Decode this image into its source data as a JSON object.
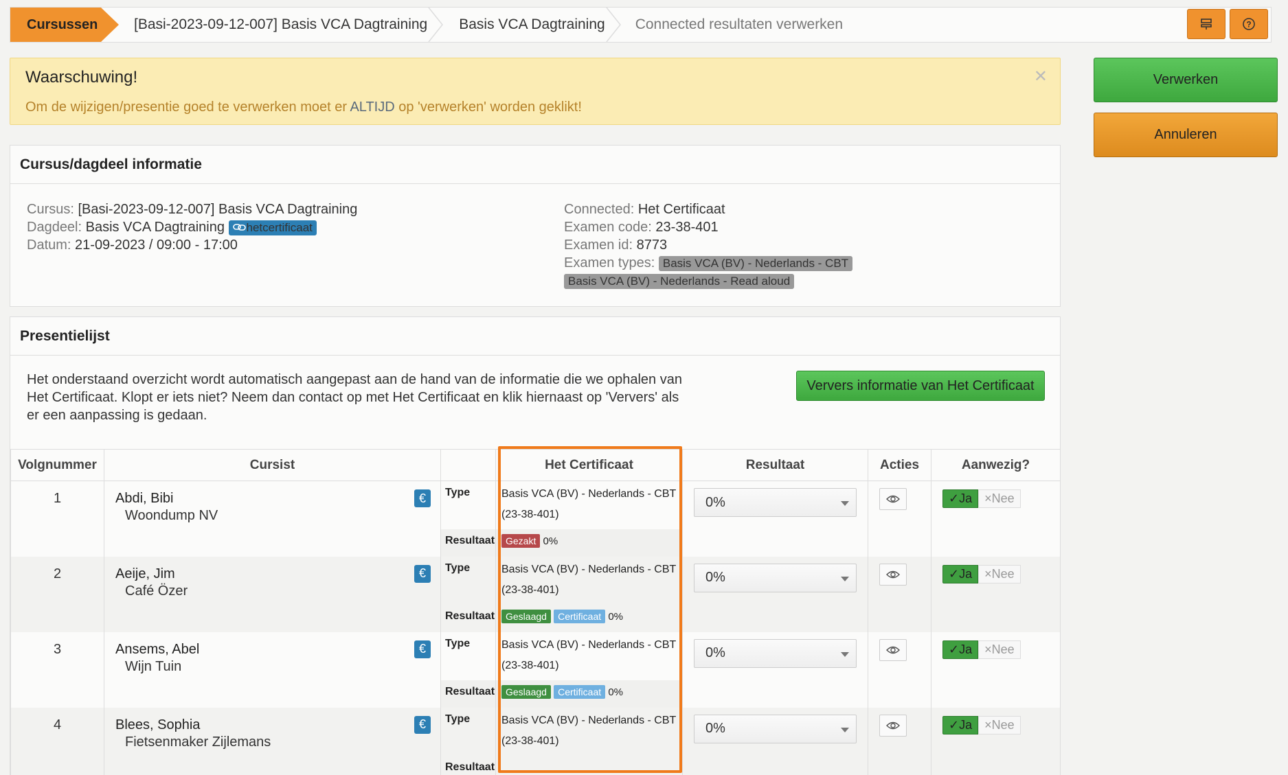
{
  "breadcrumb": {
    "home": "Cursussen",
    "items": [
      "[Basi-2023-09-12-007] Basis VCA Dagtraining",
      "Basis VCA Dagtraining"
    ],
    "current": "Connected resultaten verwerken"
  },
  "alert": {
    "title": "Waarschuwing!",
    "text_before": "Om de wijzigen/presentie goed te verwerken moet er ",
    "emphasis": "ALTIJD",
    "text_after": " op 'verwerken' worden geklikt!"
  },
  "actions": {
    "process": "Verwerken",
    "cancel": "Annuleren"
  },
  "info_panel": {
    "title": "Cursus/dagdeel informatie",
    "cursus_label": "Cursus:",
    "cursus_value": "[Basi-2023-09-12-007] Basis VCA Dagtraining",
    "dagdeel_label": "Dagdeel:",
    "dagdeel_value": "Basis VCA Dagtraining",
    "dagdeel_tag": "hetcertificaat",
    "datum_label": "Datum:",
    "datum_value": "21-09-2023 / 09:00 - 17:00",
    "connected_label": "Connected:",
    "connected_value": "Het Certificaat",
    "code_label": "Examen code:",
    "code_value": "23-38-401",
    "id_label": "Examen id:",
    "id_value": "8773",
    "types_label": "Examen types:",
    "types": [
      "Basis VCA (BV) - Nederlands - CBT",
      "Basis VCA (BV) - Nederlands - Read aloud"
    ]
  },
  "presentie": {
    "title": "Presentielijst",
    "description": "Het onderstaand overzicht wordt automatisch aangepast aan de hand van de informatie die we ophalen van Het Certificaat. Klopt er iets niet? Neem dan contact op met Het Certificaat en klik hiernaast op 'Ververs' als er een aanpassing is gedaan.",
    "refresh_button": "Ververs informatie van Het Certificaat",
    "columns": [
      "Volgnummer",
      "Cursist",
      "",
      "Het Certificaat",
      "Resultaat",
      "Acties",
      "Aanwezig?"
    ],
    "type_label": "Type",
    "result_label": "Resultaat",
    "yes": "Ja",
    "no": "Nee",
    "rows": [
      {
        "nr": "1",
        "name": "Abdi, Bibi",
        "company": "Woondump NV",
        "type": "Basis VCA (BV) - Nederlands - CBT (23-38-401)",
        "status": "Gezakt",
        "cert": "",
        "score": "0%",
        "result": "0%"
      },
      {
        "nr": "2",
        "name": "Aeije, Jim",
        "company": "Café Özer",
        "type": "Basis VCA (BV) - Nederlands - CBT (23-38-401)",
        "status": "Geslaagd",
        "cert": "Certificaat",
        "score": "0%",
        "result": "0%"
      },
      {
        "nr": "3",
        "name": "Ansems, Abel",
        "company": "Wijn Tuin",
        "type": "Basis VCA (BV) - Nederlands - CBT (23-38-401)",
        "status": "Geslaagd",
        "cert": "Certificaat",
        "score": "0%",
        "result": "0%"
      },
      {
        "nr": "4",
        "name": "Blees, Sophia",
        "company": "Fietsenmaker Zijlemans",
        "type": "Basis VCA (BV) - Nederlands - CBT (23-38-401)",
        "status": "",
        "cert": "",
        "score": "",
        "result": "0%"
      }
    ]
  },
  "colors": {
    "accent": "#f0922e",
    "green": "#3ea83e",
    "highlight": "#f07a1a"
  }
}
